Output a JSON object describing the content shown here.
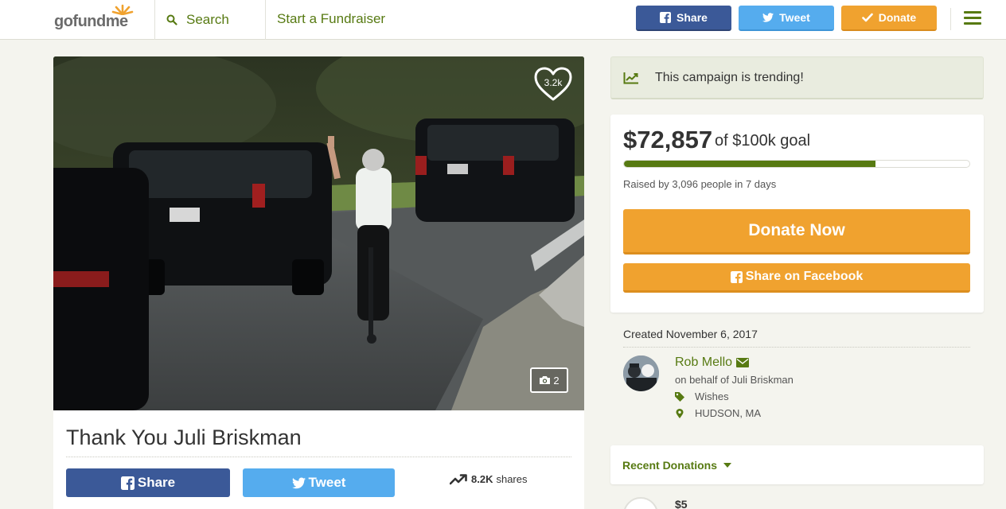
{
  "brand": {
    "logo_text_a": "gofund",
    "logo_text_b": "me",
    "accent": "#577a12",
    "orange": "#f0a22f",
    "facebook_blue": "#3b5998",
    "twitter_blue": "#55acee"
  },
  "nav": {
    "search_label": "Search",
    "start_label": "Start a Fundraiser",
    "share_label": "Share",
    "tweet_label": "Tweet",
    "donate_label": "Donate",
    "menu_icon": "hamburger-icon"
  },
  "campaign": {
    "title": "Thank You Juli Briskman",
    "hearts": "3.2k",
    "photo_count": "2",
    "share_button": "Share",
    "tweet_button": "Tweet",
    "shares_count": "8.2K",
    "shares_label": "shares"
  },
  "trending": {
    "text": "This campaign is trending!"
  },
  "stats": {
    "raised": "$72,857",
    "goal": "of $100k goal",
    "progress_fraction": 0.72857,
    "raised_by": "Raised by 3,096 people in 7 days",
    "donate_now": "Donate Now",
    "share_facebook": "Share on Facebook"
  },
  "organizer": {
    "created": "Created November 6, 2017",
    "name": "Rob Mello",
    "on_behalf": "on behalf of Juli Briskman",
    "category": "Wishes",
    "location": "HUDSON, MA"
  },
  "donations": {
    "heading": "Recent Donations",
    "first_amount": "$5"
  }
}
